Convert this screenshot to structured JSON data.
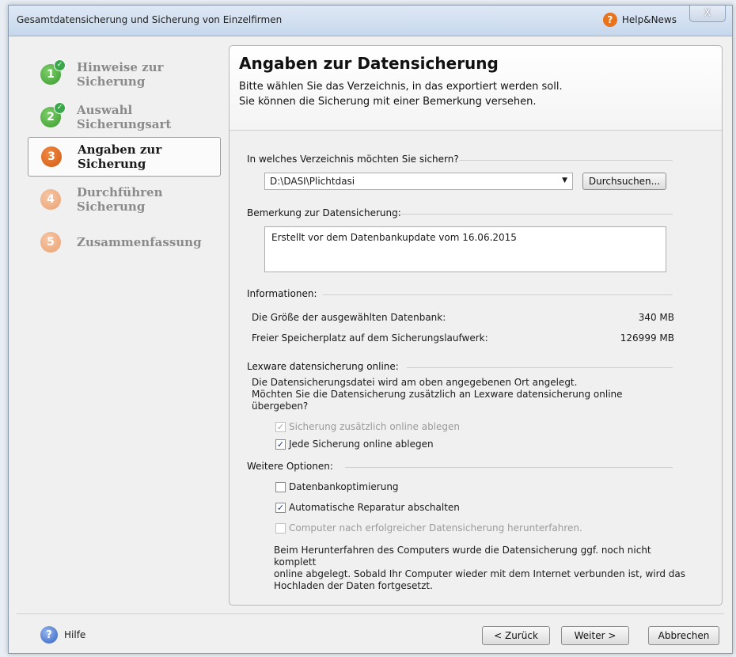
{
  "window": {
    "title": "Gesamtdatensicherung und Sicherung von Einzelfirmen",
    "help_news": "Help&News",
    "close": "X"
  },
  "steps": [
    {
      "num": "1",
      "label": "Hinweise zur Sicherung"
    },
    {
      "num": "2",
      "label": "Auswahl Sicherungsart"
    },
    {
      "num": "3",
      "label": "Angaben zur Sicherung"
    },
    {
      "num": "4",
      "label": "Durchführen Sicherung"
    },
    {
      "num": "5",
      "label": "Zusammenfassung"
    }
  ],
  "header": {
    "title": "Angaben zur Datensicherung",
    "sub1": "Bitte wählen Sie das Verzeichnis, in das exportiert werden soll.",
    "sub2": "Sie können die Sicherung mit einer Bemerkung versehen."
  },
  "directory": {
    "label": "In welches Verzeichnis möchten Sie sichern?",
    "value": "D:\\DASI\\Plichtdasi",
    "browse": "Durchsuchen..."
  },
  "remark": {
    "label": "Bemerkung zur Datensicherung:",
    "value": "Erstellt vor dem Datenbankupdate vom 16.06.2015"
  },
  "info": {
    "label": "Informationen:",
    "db_size_label": "Die Größe der ausgewählten Datenbank:",
    "db_size_value": "340 MB",
    "free_label": "Freier Speicherplatz auf dem Sicherungslaufwerk:",
    "free_value": "126999 MB"
  },
  "online": {
    "label": "Lexware datensicherung online:",
    "text1": "Die Datensicherungsdatei wird am oben angegebenen Ort angelegt.",
    "text2": "Möchten Sie die Datensicherung zusätzlich an Lexware datensicherung online",
    "text3": "übergeben?",
    "cb1": "Sicherung zusätzlich online ablegen",
    "cb2": "Jede Sicherung online ablegen"
  },
  "options": {
    "label": "Weitere Optionen:",
    "cb1": "Datenbankoptimierung",
    "cb2": "Automatische Reparatur abschalten",
    "cb3": "Computer nach erfolgreicher Datensicherung herunterfahren.",
    "note1": "Beim Herunterfahren des Computers wurde die Datensicherung ggf. noch nicht komplett",
    "note2": "online abgelegt. Sobald Ihr Computer wieder mit dem Internet verbunden ist, wird das",
    "note3": "Hochladen der Daten fortgesetzt."
  },
  "footer": {
    "help": "Hilfe",
    "back": "< Zurück",
    "next": "Weiter >",
    "cancel": "Abbrechen"
  },
  "checkmark": "✓"
}
